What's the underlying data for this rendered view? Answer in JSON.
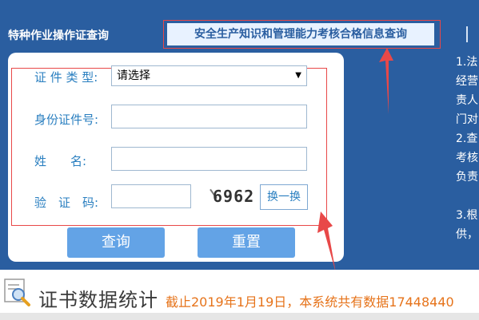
{
  "tabs": {
    "left_label": "特种作业操作证查询",
    "active_label": "安全生产知识和管理能力考核合格信息查询"
  },
  "form": {
    "cert_type_label": "证 件 类 型:",
    "cert_type_value": "请选择",
    "id_label": "身份证件号:",
    "name_label": "姓　　名:",
    "captcha_label": "验　证　码:",
    "captcha_code": "6962",
    "swap_label": "换一换",
    "query_label": "查询",
    "reset_label": "重置"
  },
  "right_notes": [
    "1.法",
    "经营",
    "责人",
    "门对",
    "2.查",
    "考核",
    "负责",
    "",
    "3.根",
    "供，"
  ],
  "stats": {
    "title": "证书数据统计",
    "info": "截止2019年1月19日，本系统共有数据17448440"
  },
  "colors": {
    "header_bg": "#2a5ea0",
    "highlight_border": "#e84848",
    "label_blue": "#2a7fc0",
    "button_blue": "#63a3e6",
    "info_orange": "#e6731a"
  }
}
